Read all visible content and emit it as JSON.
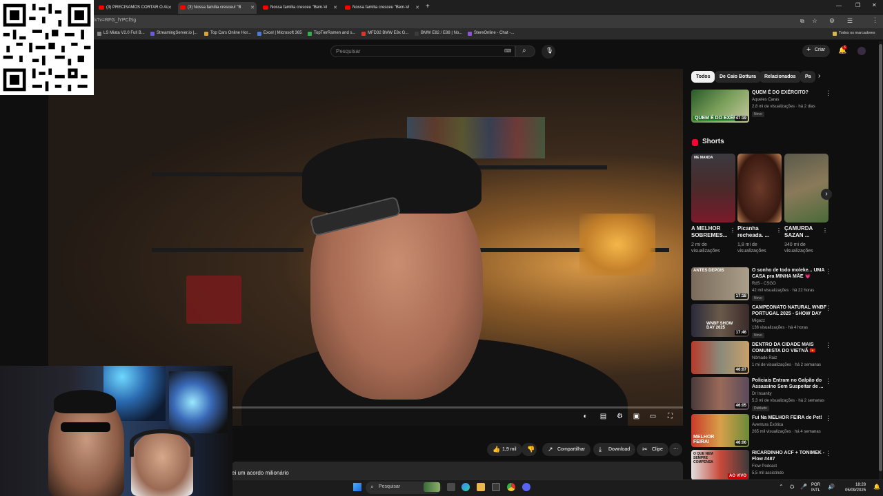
{
  "browser": {
    "tabs": [
      {
        "title": "(3) PRECISAMOS CORTAR O AL"
      },
      {
        "title": "(3) Nossa família cresceu! \"B"
      },
      {
        "title": "Nossa família cresceu \"Bem-Vi"
      },
      {
        "title": "Nossa família cresceu \"Bem-Vi"
      }
    ],
    "new_tab": "+",
    "url": "k?v=RFG_lYPCfSg",
    "bookmarks": [
      {
        "label": "LS Miata V2.0 Full B...",
        "color": "#e0342b"
      },
      {
        "label": "StreamingServer.io |...",
        "color": "#6b5bd6"
      },
      {
        "label": "Top Cars Online Hor...",
        "color": "#d9a23a"
      },
      {
        "label": "Excel | Microsoft 365",
        "color": "#4a7bd8"
      },
      {
        "label": "TopTierRamen and s...",
        "color": "#2fb24c"
      },
      {
        "label": "MFD32 BMW E8x G...",
        "color": "#e0342b"
      },
      {
        "label": "BMW E82 / E88 | No...",
        "color": "#3b3b3b"
      },
      {
        "label": "StereOnline - Chat -...",
        "color": "#8e53d6"
      }
    ],
    "all_bookmarks": "Todos os marcadores"
  },
  "youtube": {
    "search_placeholder": "Pesquisar",
    "create_label": "Criar",
    "notification_count": "3"
  },
  "video": {
    "description_line": "ei um acordo milionário",
    "likes": "1,9 mil",
    "share": "Compartilhar",
    "download": "Download",
    "clip": "Clipe"
  },
  "sidebar": {
    "chips": [
      "Todos",
      "De Caio Bottura",
      "Relacionados",
      "Pa"
    ],
    "first_video": {
      "title": "QUEM É DO EXÉRCITO?",
      "channel": "Aqueles Caras",
      "meta": "2,8 mi de visualizações · há 2 dias",
      "badge": "Novo",
      "duration": "47:19",
      "thumb_text": "QUEM É DO EXÉRC"
    },
    "shorts_title": "Shorts",
    "shorts": [
      {
        "title": "A MELHOR SOBREMES...",
        "views": "2 mi de visualizações",
        "thumb_text": "ME MANDA"
      },
      {
        "title": "Picanha recheada. ...",
        "views": "1,8 mi de visualizações",
        "thumb_text": ""
      },
      {
        "title": "ÇAMURDA SAZAN ...",
        "views": "340 mi de visualizações",
        "thumb_text": ""
      }
    ],
    "videos": [
      {
        "title": "O sonho de todo moleke... UMA CASA pra MINHA MÃE 💗",
        "channel": "RdS - CSGO",
        "meta": "42 mil visualizações · há 22 horas",
        "badge": "Novo",
        "duration": "17:18",
        "thumb_text": "ANTES DEPOIS"
      },
      {
        "title": "CAMPEONATO NATURAL WNBF PORTUGAL 2025 - SHOW DAY",
        "channel": "Migazz",
        "meta": "136 visualizações · há 4 horas",
        "badge": "Novo",
        "duration": "17:46",
        "thumb_text": "WNBF SHOW DAY 2025"
      },
      {
        "title": "DENTRO DA CIDADE MAIS COMUNISTA DO VIETNÃ 🇻🇳",
        "channel": "Nômade Raiz",
        "meta": "1 mi de visualizações · há 2 semanas",
        "badge": "",
        "duration": "46:07",
        "thumb_text": ""
      },
      {
        "title": "Policiais Entram no Galpão do Assassino Sem Suspeitar de ...",
        "channel": "Dr Insanity",
        "meta": "5,3 mi de visualizações · há 2 semanas",
        "badge": "Dublado",
        "duration": "46:05",
        "thumb_text": ""
      },
      {
        "title": "Fui Na MELHOR FEIRA de Pet!",
        "channel": "Aventura Exótica",
        "meta": "265 mil visualizações · há 4 semanas",
        "badge": "",
        "duration": "46:06",
        "thumb_text": "MELHOR FEIRA!"
      },
      {
        "title": "RICARDINHO ACF + TONIMEK - Flow #487",
        "channel": "Flow Podcast",
        "meta": "5,5 mil assistindo",
        "badge": "",
        "duration": "AO VIVO",
        "thumb_text": "O QUE NEM SEMPRE COMPENSA"
      }
    ]
  },
  "taskbar": {
    "search_placeholder": "Pesquisar",
    "lang_top": "POR",
    "lang_bottom": "INTL",
    "time": "18:28",
    "date": "05/09/2025"
  },
  "colors": {
    "yt_red": "#ff0000",
    "bg": "#0f0f0f",
    "chip": "#272727"
  }
}
